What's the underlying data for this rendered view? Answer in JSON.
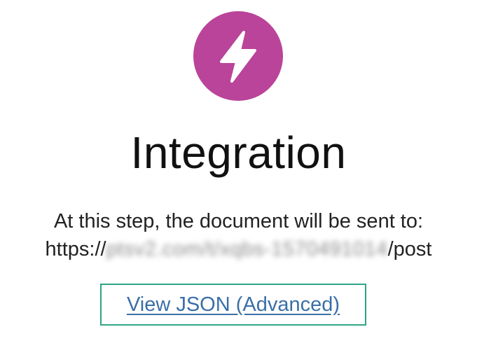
{
  "step": {
    "icon": "lightning-bolt-icon",
    "icon_color": "#b9449a",
    "title": "Integration",
    "description": "At this step, the document will be sent to:",
    "url_prefix": "https://",
    "url_hidden": "ptsv2.com/t/xqbs-1570491014",
    "url_suffix": "/post"
  },
  "actions": {
    "view_json_label": "View JSON (Advanced)",
    "focus_color": "#2fa585",
    "link_color": "#3a6fa8"
  }
}
